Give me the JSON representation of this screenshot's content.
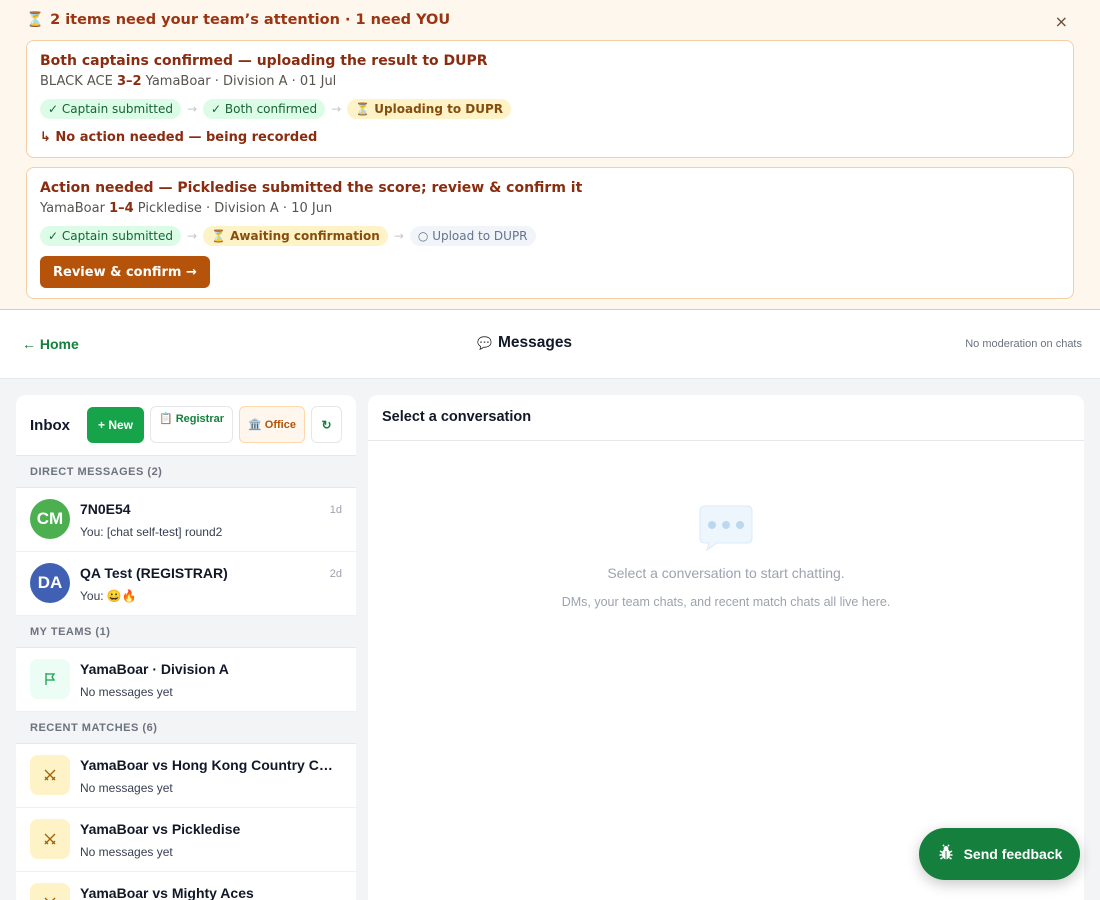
{
  "banner": {
    "heading_icon": "⏳",
    "heading": "2 items need your team’s attention · 1 need YOU",
    "close": "×",
    "cards": [
      {
        "title": "Both captains confirmed — uploading the result to DUPR",
        "sub_left": "BLACK ACE ",
        "score": "3–2",
        "sub_right": " YamaBoar · Division A · 01 Jul",
        "steps": [
          {
            "label": "✓ Captain submitted",
            "state": "done"
          },
          {
            "label": "✓ Both confirmed",
            "state": "done"
          },
          {
            "label": "⏳ Uploading to DUPR",
            "state": "current"
          }
        ],
        "note": "↳ No action needed — being recorded"
      },
      {
        "title": "Action needed — Pickledise submitted the score; review & confirm it",
        "sub_left": "YamaBoar ",
        "score": "1–4",
        "sub_right": " Pickledise · Division A · 10 Jun",
        "steps": [
          {
            "label": "✓ Captain submitted",
            "state": "done"
          },
          {
            "label": "⏳ Awaiting confirmation",
            "state": "current"
          },
          {
            "label": "○ Upload to DUPR",
            "state": "pending"
          }
        ],
        "button": "Review & confirm →"
      }
    ],
    "step_arrow": "→"
  },
  "header": {
    "home": "← Home",
    "title_icon": "💬",
    "title": "Messages",
    "moderation": "No moderation on chats"
  },
  "sidebar": {
    "inbox": "Inbox",
    "new_btn": "+ New",
    "registrar_btn": "📋 Registrar",
    "office_btn": "🏛️ Office",
    "refresh_btn": "↻",
    "direct_header": "DIRECT MESSAGES (2)",
    "direct": [
      {
        "initials": "CM",
        "name": "7N0E54",
        "preview": "You: [chat self-test] round2",
        "time": "1d"
      },
      {
        "initials": "DA",
        "name": "QA Test (REGISTRAR)",
        "preview": "You: 😀🔥",
        "time": "2d"
      }
    ],
    "teams_header": "MY TEAMS (1)",
    "teams": [
      {
        "icon": "flag-icon",
        "name": "YamaBoar · Division A",
        "preview": "No messages yet"
      }
    ],
    "matches_header": "RECENT MATCHES (6)",
    "matches": [
      {
        "icon": "crossed-swords-icon",
        "name": "YamaBoar vs Hong Kong Country Club",
        "preview": "No messages yet"
      },
      {
        "icon": "crossed-swords-icon",
        "name": "YamaBoar vs Pickledise",
        "preview": "No messages yet"
      },
      {
        "icon": "crossed-swords-icon",
        "name": "YamaBoar vs Mighty Aces",
        "preview": ""
      }
    ]
  },
  "conversation": {
    "header": "Select a conversation",
    "empty_title": "Select a conversation to start chatting.",
    "empty_sub": "DMs, your team chats, and recent match chats all live here."
  },
  "feedback": {
    "label": "Send feedback",
    "icon": "bug-icon"
  },
  "colors": {
    "accent_green": "#15803d",
    "banner_bg": "#fef7ee",
    "warning_brown": "#8a2c10",
    "action_orange": "#b45309"
  }
}
